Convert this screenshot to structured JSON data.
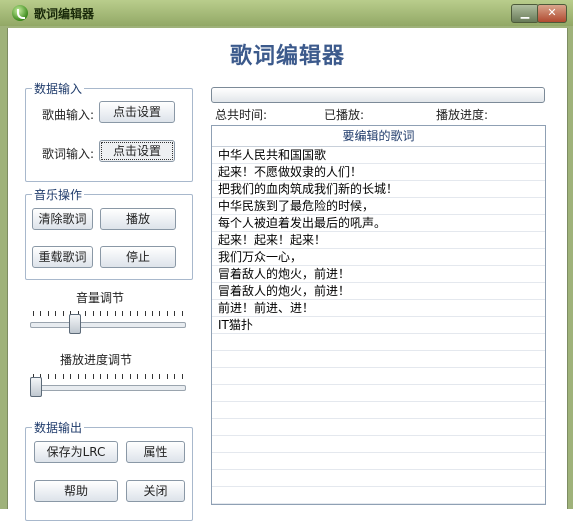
{
  "window": {
    "title": "歌词编辑器",
    "minimize_label": "▁",
    "close_label": "✕"
  },
  "header": {
    "title": "歌词编辑器"
  },
  "data_input": {
    "legend": "数据输入",
    "song_label": "歌曲输入:",
    "song_button": "点击设置",
    "lyric_label": "歌词输入:",
    "lyric_button": "点击设置"
  },
  "music_ops": {
    "legend": "音乐操作",
    "clear_button": "清除歌词",
    "play_button": "播放",
    "reload_button": "重载歌词",
    "stop_button": "停止"
  },
  "volume": {
    "label": "音量调节",
    "level": 0.27
  },
  "seek": {
    "label": "播放进度调节",
    "level": 0.0
  },
  "data_output": {
    "legend": "数据输出",
    "save_button": "保存为LRC",
    "props_button": "属性",
    "help_button": "帮助",
    "close_button": "关闭"
  },
  "status": {
    "total_time": "总共时间:",
    "played": "已播放:",
    "progress": "播放进度:",
    "progress_level": 0.0
  },
  "lyrics": {
    "header": "要编辑的歌词",
    "lines": [
      "中华人民共和国国歌",
      "起来！不愿做奴隶的人们！",
      "把我们的血肉筑成我们新的长城！",
      "中华民族到了最危险的时候，",
      "每个人被迫着发出最后的吼声。",
      "起来！起来！起来！",
      "我们万众一心，",
      "冒着敌人的炮火，前进！",
      "冒着敌人的炮火，前进！",
      "前进！前进、进！",
      "IT猫扑",
      "",
      "",
      "",
      "",
      "",
      "",
      "",
      "",
      "",
      ""
    ]
  }
}
